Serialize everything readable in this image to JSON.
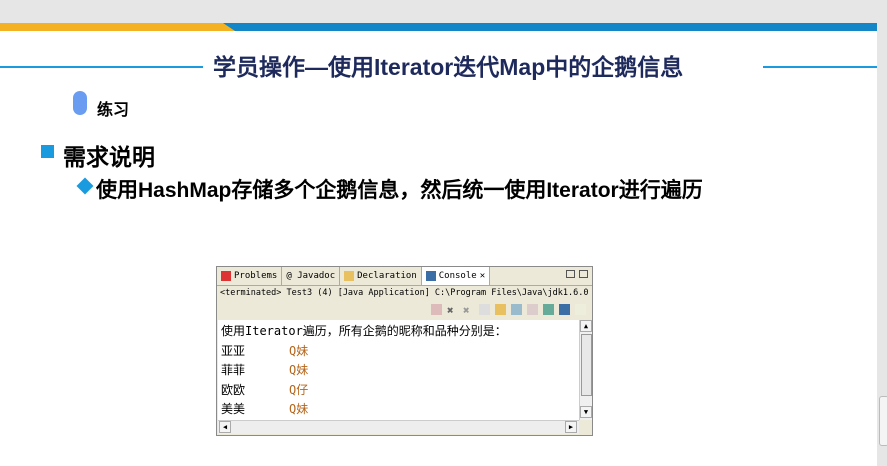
{
  "slide": {
    "title": "学员操作—使用Iterator迭代Map中的企鹅信息",
    "exercise_label": "练习",
    "heading": "需求说明",
    "bullet": "使用HashMap存储多个企鹅信息，然后统一使用Iterator进行遍历"
  },
  "eclipse": {
    "tabs": [
      {
        "label": "Problems"
      },
      {
        "label": "@ Javadoc"
      },
      {
        "label": "Declaration"
      },
      {
        "label": "Console"
      }
    ],
    "status": "<terminated> Test3 (4) [Java Application] C:\\Program Files\\Java\\jdk1.6.0",
    "console_lines": [
      {
        "name": "使用Iterator遍历，所有企鹅的昵称和品种分别是：",
        "type": ""
      },
      {
        "name": "亚亚",
        "type": "Q妹"
      },
      {
        "name": "菲菲",
        "type": "Q妹"
      },
      {
        "name": "欧欧",
        "type": "Q仔"
      },
      {
        "name": "美美",
        "type": "Q妹"
      }
    ]
  },
  "colors": {
    "accent": "#1a9be0",
    "title": "#1f2a5c",
    "yellow": "#f4b223",
    "blue": "#1386c8"
  }
}
